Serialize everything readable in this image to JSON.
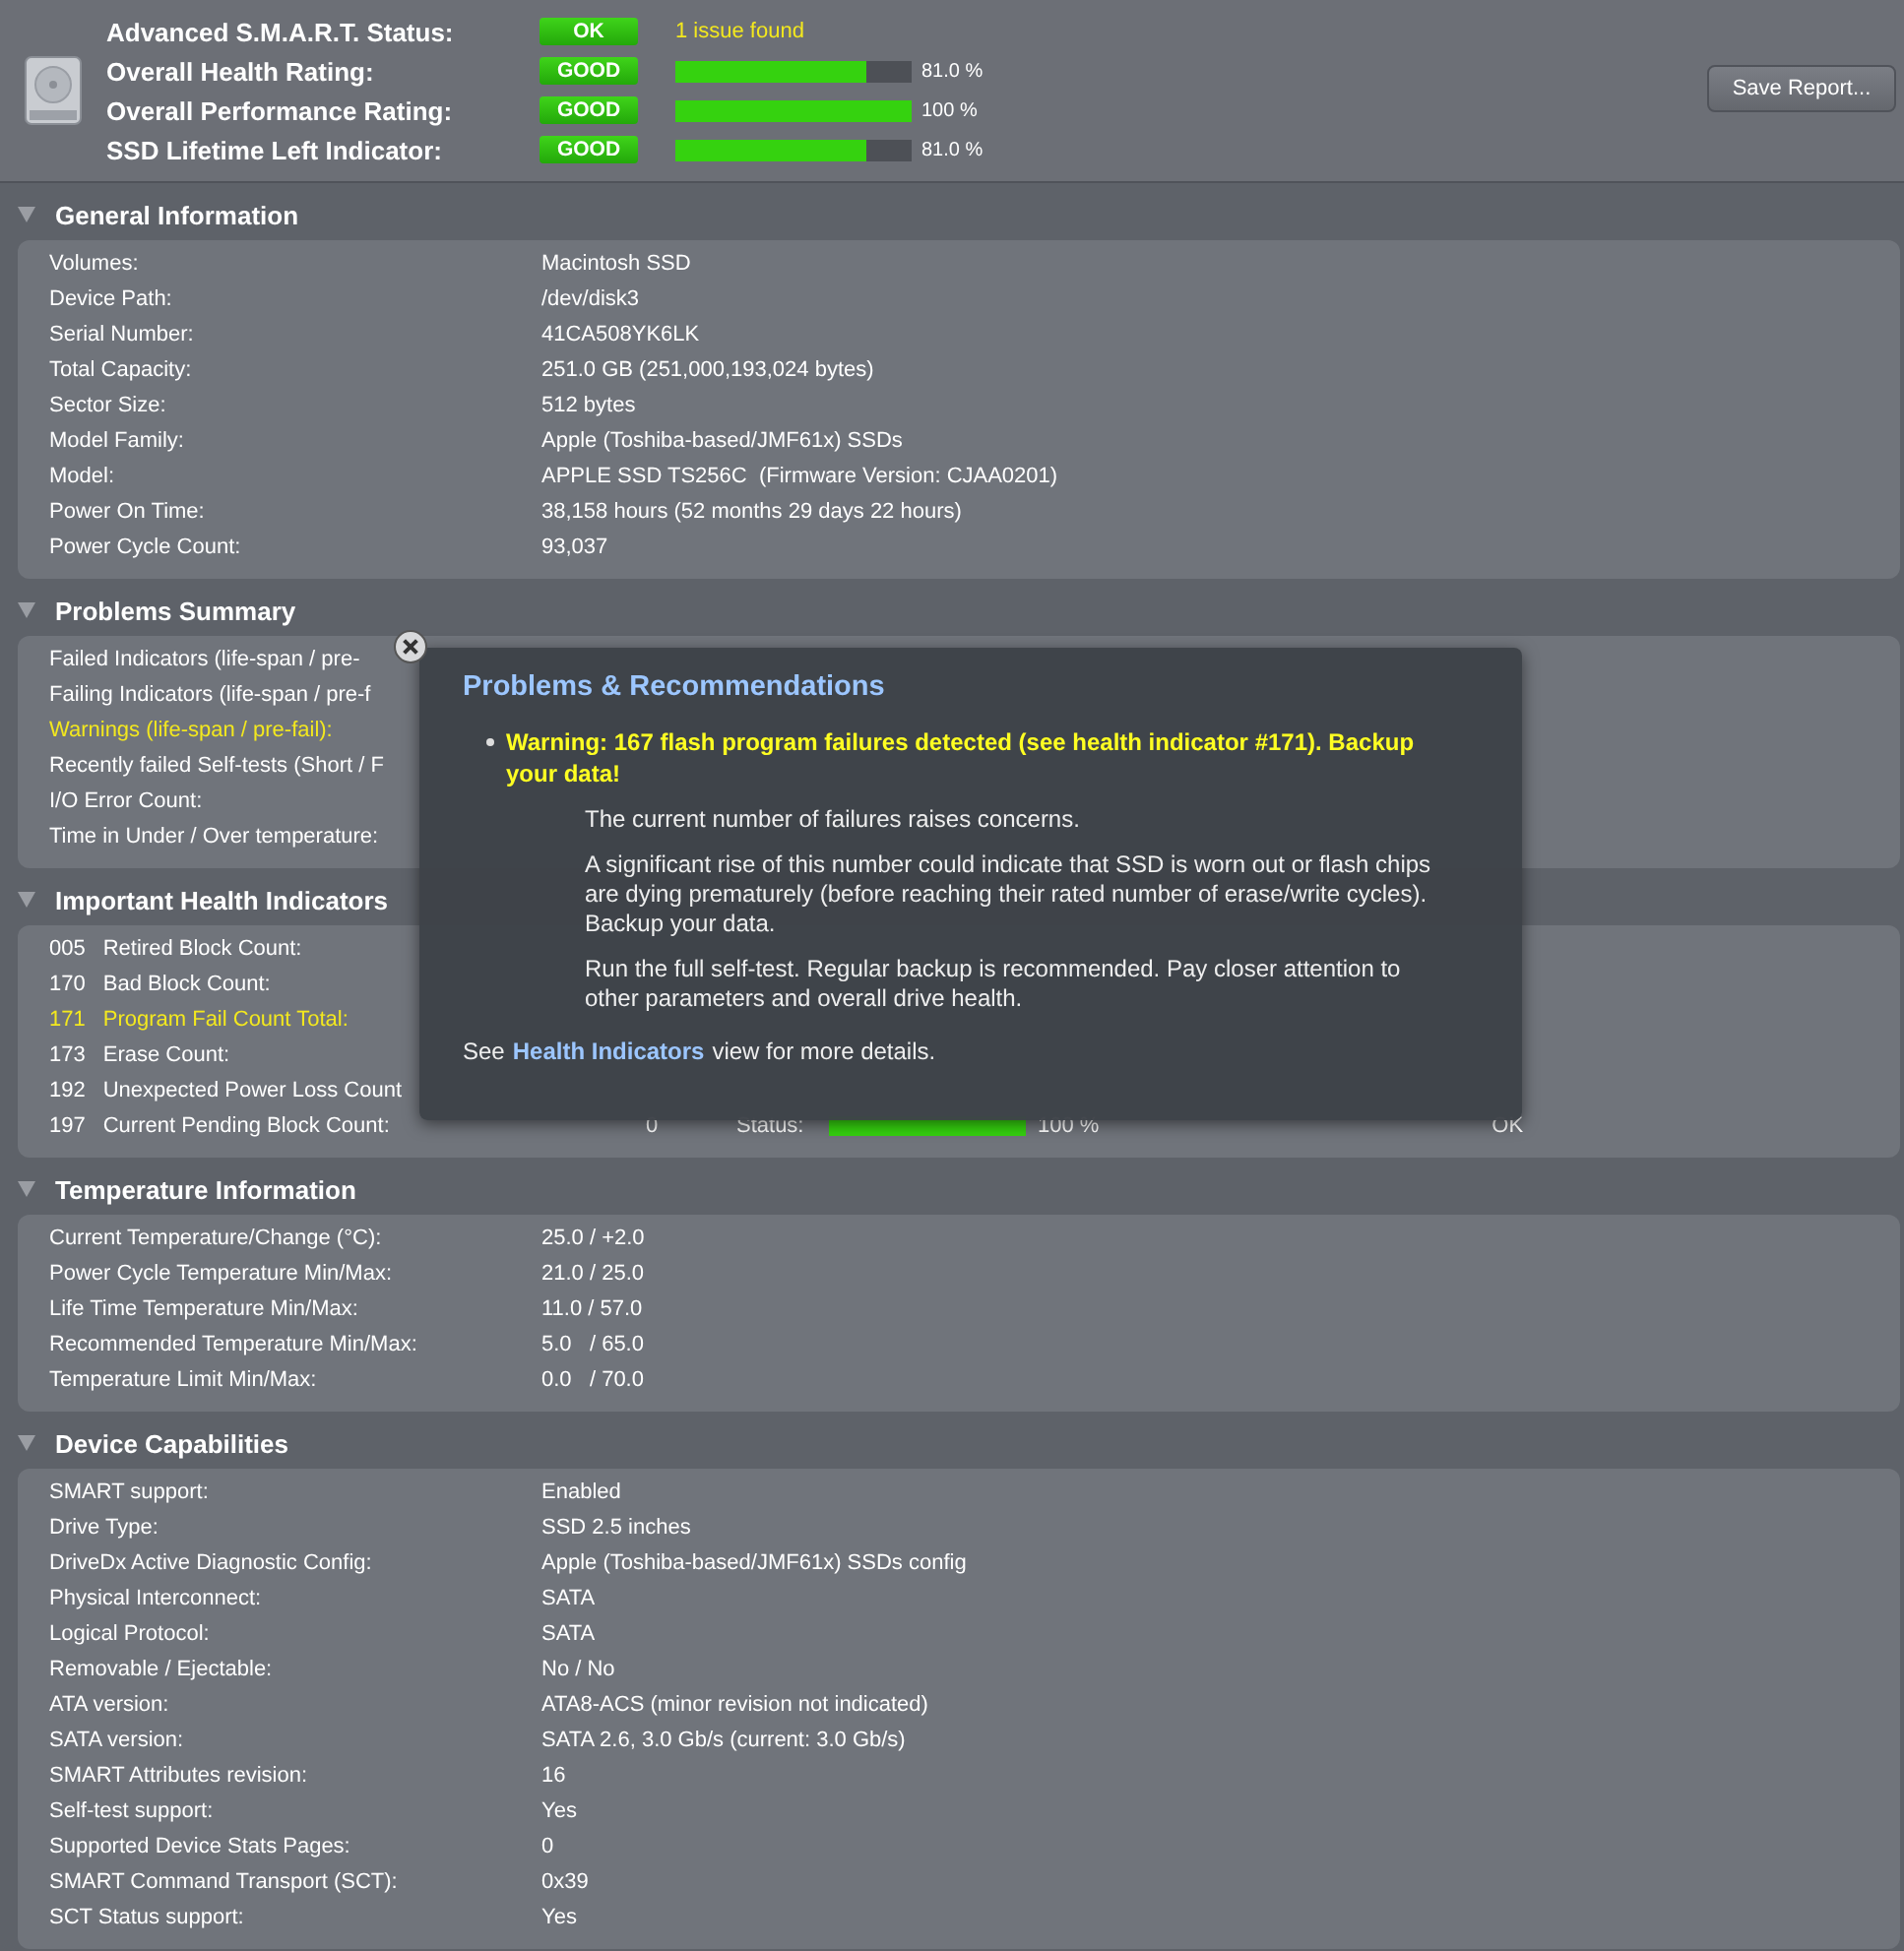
{
  "summary": {
    "rows": [
      {
        "label": "Advanced S.M.A.R.T. Status:",
        "badge": "OK",
        "note": "1 issue found"
      },
      {
        "label": "Overall Health Rating:",
        "badge": "GOOD",
        "level": 0.81,
        "reading": "81.0 %"
      },
      {
        "label": "Overall Performance Rating:",
        "badge": "GOOD",
        "level": 1.0,
        "reading": "100 %"
      },
      {
        "label": "SSD Lifetime Left Indicator:",
        "badge": "GOOD",
        "level": 0.81,
        "reading": "81.0 %"
      }
    ],
    "save_button": "Save Report..."
  },
  "sections": [
    {
      "title": "General Information",
      "expanded": true,
      "kind": "props",
      "rows": [
        {
          "label": "Volumes:",
          "value": "Macintosh SSD"
        },
        {
          "label": "Device Path:",
          "value": "/dev/disk3"
        },
        {
          "label": "Serial Number:",
          "value": "41CA508YK6LK"
        },
        {
          "label": "Total Capacity:",
          "value": "251.0 GB (251,000,193,024 bytes)"
        },
        {
          "label": "Sector Size:",
          "value": "512 bytes"
        },
        {
          "label": "Model Family:",
          "value": "Apple (Toshiba-based/JMF61x) SSDs"
        },
        {
          "label": "Model:",
          "value": "APPLE SSD TS256C  (Firmware Version: CJAA0201)"
        },
        {
          "label": "Power On Time:",
          "value": "38,158 hours (52 months 29 days 22 hours)"
        },
        {
          "label": "Power Cycle Count:",
          "value": "93,037"
        }
      ]
    },
    {
      "title": "Problems Summary",
      "expanded": true,
      "kind": "props",
      "rows": [
        {
          "label": "Failed Indicators (life-span / pre-",
          "warning": false
        },
        {
          "label": "Failing Indicators (life-span / pre-f",
          "warning": false
        },
        {
          "label": "Warnings (life-span / pre-fail):",
          "warning": true
        },
        {
          "label": "Recently failed Self-tests (Short / F",
          "warning": false
        },
        {
          "label": "I/O Error Count:",
          "warning": false
        },
        {
          "label": "Time in Under / Over temperature:",
          "warning": false
        }
      ]
    },
    {
      "title": "Important Health Indicators",
      "expanded": true,
      "kind": "health",
      "rows": [
        {
          "code": "005",
          "label": "Retired Block Count:",
          "warning": false
        },
        {
          "code": "170",
          "label": "Bad Block Count:",
          "warning": false
        },
        {
          "code": "171",
          "label": "Program Fail Count Total:",
          "warning": true
        },
        {
          "code": "173",
          "label": "Erase Count:",
          "warning": false
        },
        {
          "code": "192",
          "label": "Unexpected Power Loss Count",
          "warning": false
        },
        {
          "code": "197",
          "label": "Current Pending Block Count:",
          "warning": false,
          "value": "0",
          "status": "Status:",
          "level": 1.0,
          "reading": "100 %",
          "result": "OK"
        }
      ]
    },
    {
      "title": "Temperature Information",
      "expanded": true,
      "kind": "props",
      "rows": [
        {
          "label": "Current Temperature/Change (°C):",
          "value": "25.0 / +2.0"
        },
        {
          "label": "Power Cycle Temperature Min/Max:",
          "value": "21.0 / 25.0"
        },
        {
          "label": "Life Time Temperature Min/Max:",
          "value": "11.0 / 57.0"
        },
        {
          "label": "Recommended Temperature Min/Max:",
          "value": "5.0   / 65.0"
        },
        {
          "label": "Temperature Limit Min/Max:",
          "value": "0.0   / 70.0"
        }
      ]
    },
    {
      "title": "Device Capabilities",
      "expanded": true,
      "kind": "props",
      "rows": [
        {
          "label": "SMART support:",
          "value": "Enabled"
        },
        {
          "label": "Drive Type:",
          "value": "SSD 2.5 inches"
        },
        {
          "label": "DriveDx Active Diagnostic Config:",
          "value": "Apple (Toshiba-based/JMF61x) SSDs config"
        },
        {
          "label": "Physical Interconnect:",
          "value": "SATA"
        },
        {
          "label": "Logical Protocol:",
          "value": "SATA"
        },
        {
          "label": "Removable / Ejectable:",
          "value": "No / No"
        },
        {
          "label": "ATA version:",
          "value": "ATA8-ACS (minor revision not indicated)"
        },
        {
          "label": "SATA version:",
          "value": "SATA 2.6, 3.0 Gb/s (current: 3.0 Gb/s)"
        },
        {
          "label": "SMART Attributes revision:",
          "value": "16"
        },
        {
          "label": "Self-test support:",
          "value": "Yes"
        },
        {
          "label": "Supported Device Stats Pages:",
          "value": "0"
        },
        {
          "label": "SMART Command Transport (SCT):",
          "value": "0x39"
        },
        {
          "label": "SCT Status support:",
          "value": "Yes"
        }
      ]
    }
  ],
  "popup": {
    "title": "Problems & Recommendations",
    "warning": "Warning: 167 flash program failures detected (see health indicator #171). Backup your data!",
    "paragraphs": [
      "The current number of failures raises concerns.",
      "A significant rise of this number could indicate that SSD is worn out or flash chips are dying prematurely (before reaching their rated number of erase/write cycles). Backup your data.",
      "Run the full self-test. Regular backup is recommended. Pay closer attention to other parameters and overall drive health."
    ],
    "footer_before": "See",
    "footer_link": "Health Indicators",
    "footer_after": "view for more details."
  }
}
